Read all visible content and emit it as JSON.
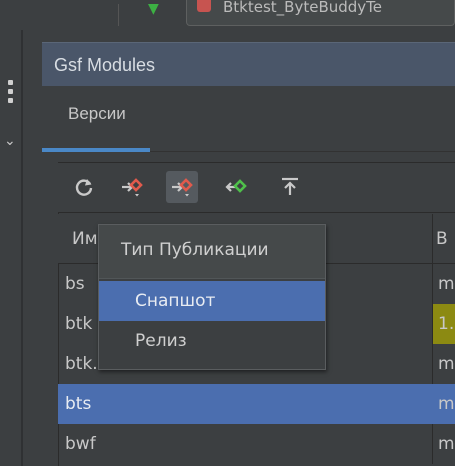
{
  "topbar": {
    "run_config": "Btktest_ByteBuddyTe"
  },
  "tool_window": {
    "title": "Gsf Modules"
  },
  "tabs": [
    {
      "label": "Версии",
      "active": true
    }
  ],
  "toolbar": {
    "buttons": [
      {
        "icon": "refresh-icon"
      },
      {
        "icon": "publish-red-icon"
      },
      {
        "icon": "publish-red-dropdown-icon",
        "pressed": true
      },
      {
        "icon": "publish-green-icon"
      },
      {
        "icon": "push-up-icon"
      }
    ]
  },
  "table": {
    "header_first": "Им",
    "header_second": "В",
    "rows": [
      {
        "name": "bs",
        "version": "m"
      },
      {
        "name": "btk",
        "version": "1.",
        "highlight": true
      },
      {
        "name": "btk...",
        "version": "m"
      },
      {
        "name": "bts",
        "version": "m",
        "selected": true
      },
      {
        "name": "bwf",
        "version": "m"
      }
    ]
  },
  "popup": {
    "title": "Тип Публикации",
    "items": [
      {
        "label": "Снапшот",
        "active": true
      },
      {
        "label": "Релиз",
        "active": false
      }
    ]
  },
  "colors": {
    "accent": "#4b6eaf",
    "header_bg": "#4a5669",
    "highlight": "#8c8a12",
    "icon_red": "#e05a4c",
    "icon_green": "#4fbf4a"
  }
}
